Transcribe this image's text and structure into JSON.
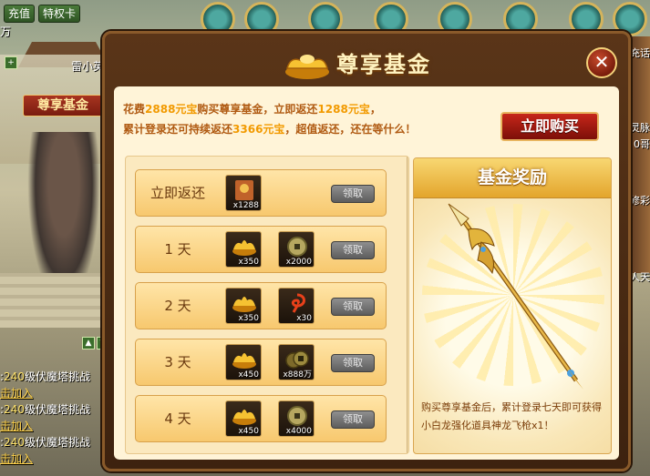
{
  "hud": {
    "recharge_label": "充值",
    "privilege_label": "特权卡",
    "side_top_fragment": "万",
    "plus_symbol": "+",
    "player_name": "雷小英",
    "tab_fund_label": "尊享基金",
    "right_labels": [
      "充话",
      "灵脉",
      "0哥",
      "修彩",
      "达人天"
    ],
    "chat_lines": [
      {
        "prefix": ":",
        "level": "240",
        "text": "级伏魔塔挑战",
        "link": "击加入"
      },
      {
        "prefix": ":",
        "level": "240",
        "text": "级伏魔塔挑战",
        "link": "击加入"
      },
      {
        "prefix": ":",
        "level": "240",
        "text": "级伏魔塔挑战",
        "link": "击加入"
      }
    ],
    "mini_up": "▲",
    "mini_down": "▼"
  },
  "panel": {
    "title": "尊享基金",
    "close_symbol": "✕",
    "promo": {
      "line1": [
        "花费",
        "2888元宝",
        "购买尊享基金，立即返还",
        "1288元宝",
        "，"
      ],
      "line2": [
        "累计登录还可持续返还",
        "3366元宝",
        "，超值返还，还在等什么！"
      ]
    },
    "buy_button": "立即购买",
    "claim_label": "领取",
    "scroll_up": "▲",
    "scroll_down": "▼",
    "rows": [
      {
        "label": "立即返还",
        "items": [
          {
            "icon": "spirit-card-icon",
            "qty": "x1288"
          }
        ]
      },
      {
        "label": "1 天",
        "items": [
          {
            "icon": "gold-ingot-icon",
            "qty": "x350"
          },
          {
            "icon": "coin-icon",
            "qty": "x2000"
          }
        ]
      },
      {
        "label": "2 天",
        "items": [
          {
            "icon": "gold-ingot-icon",
            "qty": "x350"
          },
          {
            "icon": "red-swirl-icon",
            "qty": "x30"
          }
        ]
      },
      {
        "label": "3 天",
        "items": [
          {
            "icon": "gold-ingot-icon",
            "qty": "x450"
          },
          {
            "icon": "copper-coin-icon",
            "qty": "x888万"
          }
        ]
      },
      {
        "label": "4 天",
        "items": [
          {
            "icon": "gold-ingot-icon",
            "qty": "x450"
          },
          {
            "icon": "coin-icon",
            "qty": "x4000"
          }
        ]
      }
    ],
    "reward": {
      "title": "基金奖励",
      "description": "购买尊享基金后，累计登录七天即可获得小白龙强化道具神龙飞枪x1！"
    }
  },
  "colors": {
    "panel_border": "#8a5a2a",
    "gold_text": "#f29a00",
    "promo_text": "#b05a12",
    "buy_button": "#c6261a"
  }
}
